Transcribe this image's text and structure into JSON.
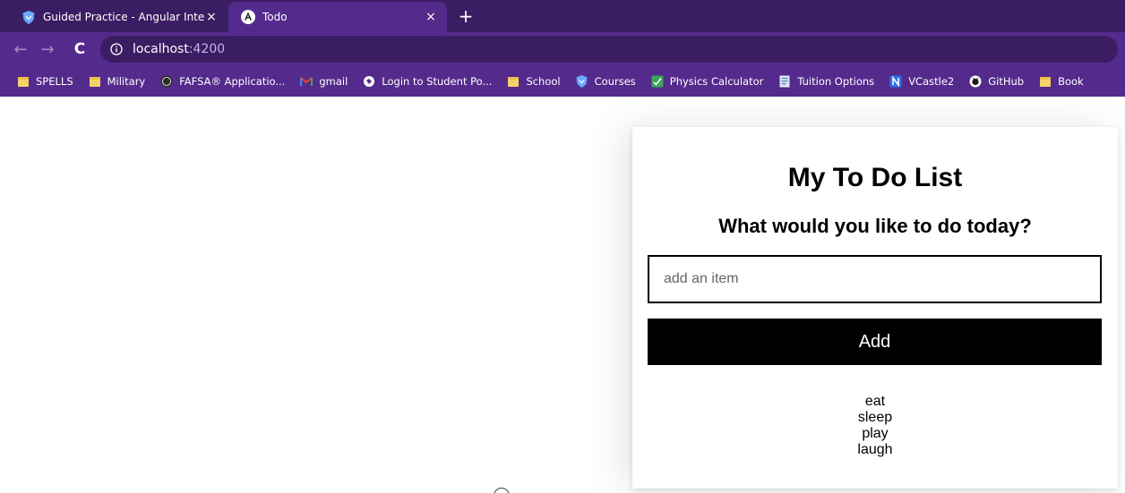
{
  "browser": {
    "tabs": [
      {
        "title": "Guided Practice - Angular Integr",
        "icon": "shield-icon",
        "active": false
      },
      {
        "title": "Todo",
        "icon": "angular-icon",
        "active": true
      }
    ],
    "new_tab_label": "+",
    "close_label": "×",
    "url": {
      "host": "localhost",
      "port": ":4200"
    },
    "bookmarks": [
      {
        "label": "SPELLS",
        "icon": "folder-icon"
      },
      {
        "label": "Military",
        "icon": "folder-icon"
      },
      {
        "label": "FAFSA® Applicatio...",
        "icon": "fafsa-icon"
      },
      {
        "label": "gmail",
        "icon": "gmail-icon"
      },
      {
        "label": "Login to Student Po...",
        "icon": "globe-icon"
      },
      {
        "label": "School",
        "icon": "folder-icon"
      },
      {
        "label": "Courses",
        "icon": "shield-icon"
      },
      {
        "label": "Physics Calculator",
        "icon": "calculator-icon"
      },
      {
        "label": "Tuition Options",
        "icon": "document-icon"
      },
      {
        "label": "VCastle2",
        "icon": "notion-icon"
      },
      {
        "label": "GitHub",
        "icon": "github-icon"
      },
      {
        "label": "Book",
        "icon": "folder-icon"
      }
    ],
    "colors": {
      "frame": "#3b1d63",
      "toolbar": "#542b8c"
    }
  },
  "app": {
    "title": "My To Do List",
    "subtitle": "What would you like to do today?",
    "input_placeholder": "add an item",
    "add_label": "Add",
    "items": [
      "eat",
      "sleep",
      "play",
      "laugh"
    ]
  }
}
